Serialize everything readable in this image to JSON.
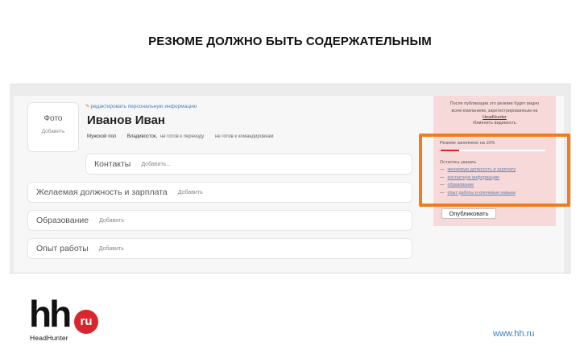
{
  "slide": {
    "title": "РЕЗЮМЕ ДОЛЖНО БЫТЬ СОДЕРЖАТЕЛЬНЫМ",
    "website": "www.hh.ru"
  },
  "logo": {
    "letters": "hh",
    "badge": "ru",
    "wordmark": "HeadHunter",
    "accent_color": "#d9262e"
  },
  "profile": {
    "photo_label": "Фото",
    "photo_add": "Добавить",
    "edit_link": "редактировать персональную информацию",
    "name": "Иванов Иван",
    "gender": "Мужской пол",
    "city": "Владивосток,",
    "relocation": "не готов к переезду",
    "business_trips": "не готов к командировкам"
  },
  "sections": {
    "contacts": {
      "label": "Контакты",
      "add": "Добавить..."
    },
    "position": {
      "label": "Желаемая должность и зарплата",
      "add": "Добавить"
    },
    "education": {
      "label": "Образование",
      "add": "Добавить"
    },
    "experience": {
      "label": "Опыт работы",
      "add": "Добавить"
    }
  },
  "side_panel": {
    "info_line1": "После публикации это резюме будет видно",
    "info_line2": "всем компаниям, зарегистрированным на",
    "info_link": "HeadHunter",
    "visibility": "Изменить видимость",
    "filled_text": "Резюме заполнено на 10%",
    "filled_percent": 10,
    "todo_title": "Осталось указать",
    "todo_items": [
      "желаемую должность и зарплату",
      "контактную информацию",
      "образование",
      "опыт работы и ключевые навыки"
    ],
    "publish_button": "Опубликовать",
    "panel_color": "#f8d9d9",
    "highlight_color": "#f07d1b"
  }
}
